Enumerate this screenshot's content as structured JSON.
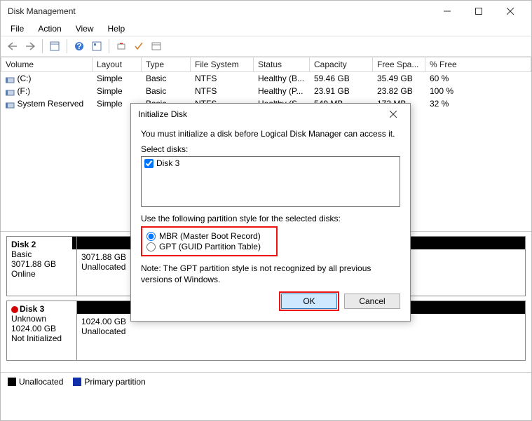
{
  "window": {
    "title": "Disk Management"
  },
  "menu": {
    "file": "File",
    "action": "Action",
    "view": "View",
    "help": "Help"
  },
  "columns": {
    "volume": "Volume",
    "layout": "Layout",
    "type": "Type",
    "fs": "File System",
    "status": "Status",
    "capacity": "Capacity",
    "free": "Free Spa...",
    "pct": "% Free"
  },
  "rows": [
    {
      "vol": "(C:)",
      "layout": "Simple",
      "type": "Basic",
      "fs": "NTFS",
      "status": "Healthy (B...",
      "cap": "59.46 GB",
      "free": "35.49 GB",
      "pct": "60 %"
    },
    {
      "vol": "(F:)",
      "layout": "Simple",
      "type": "Basic",
      "fs": "NTFS",
      "status": "Healthy (P...",
      "cap": "23.91 GB",
      "free": "23.82 GB",
      "pct": "100 %"
    },
    {
      "vol": "System Reserved",
      "layout": "Simple",
      "type": "Basic",
      "fs": "NTFS",
      "status": "Healthy (S...",
      "cap": "549 MB",
      "free": "173 MB",
      "pct": "32 %"
    }
  ],
  "disks": {
    "d2": {
      "name": "Disk 2",
      "type": "Basic",
      "size": "3071.88 GB",
      "status": "Online",
      "part_size": "3071.88 GB",
      "part_status": "Unallocated"
    },
    "d3": {
      "name": "Disk 3",
      "type": "Unknown",
      "size": "1024.00 GB",
      "status": "Not Initialized",
      "part_size": "1024.00 GB",
      "part_status": "Unallocated"
    }
  },
  "legend": {
    "unalloc": "Unallocated",
    "primary": "Primary partition"
  },
  "dialog": {
    "title": "Initialize Disk",
    "intro": "You must initialize a disk before Logical Disk Manager can access it.",
    "select_label": "Select disks:",
    "disk_option": "Disk 3",
    "style_label": "Use the following partition style for the selected disks:",
    "mbr": "MBR (Master Boot Record)",
    "gpt": "GPT (GUID Partition Table)",
    "note": "Note: The GPT partition style is not recognized by all previous versions of Windows.",
    "ok": "OK",
    "cancel": "Cancel"
  }
}
